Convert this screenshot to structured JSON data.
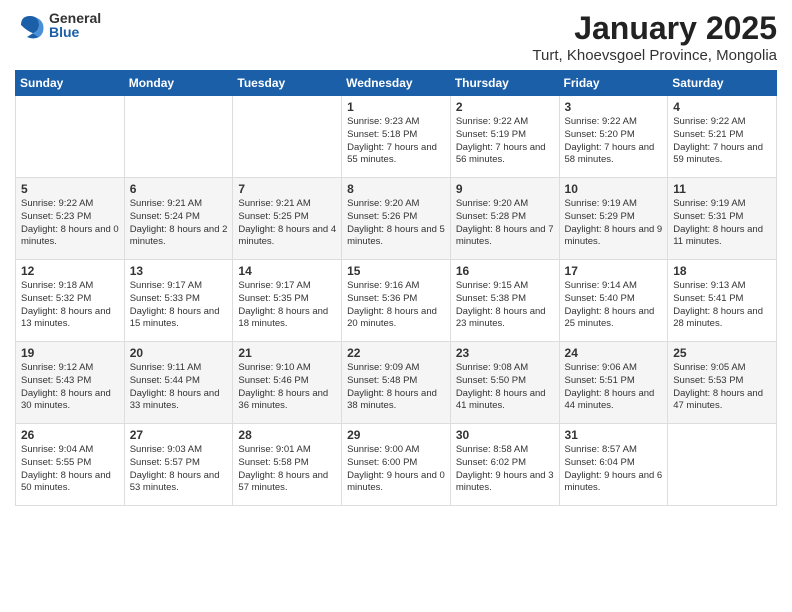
{
  "logo": {
    "general": "General",
    "blue": "Blue"
  },
  "title": "January 2025",
  "location": "Turt, Khoevsgoel Province, Mongolia",
  "weekdays": [
    "Sunday",
    "Monday",
    "Tuesday",
    "Wednesday",
    "Thursday",
    "Friday",
    "Saturday"
  ],
  "weeks": [
    [
      {
        "day": "",
        "detail": ""
      },
      {
        "day": "",
        "detail": ""
      },
      {
        "day": "",
        "detail": ""
      },
      {
        "day": "1",
        "detail": "Sunrise: 9:23 AM\nSunset: 5:18 PM\nDaylight: 7 hours\nand 55 minutes."
      },
      {
        "day": "2",
        "detail": "Sunrise: 9:22 AM\nSunset: 5:19 PM\nDaylight: 7 hours\nand 56 minutes."
      },
      {
        "day": "3",
        "detail": "Sunrise: 9:22 AM\nSunset: 5:20 PM\nDaylight: 7 hours\nand 58 minutes."
      },
      {
        "day": "4",
        "detail": "Sunrise: 9:22 AM\nSunset: 5:21 PM\nDaylight: 7 hours\nand 59 minutes."
      }
    ],
    [
      {
        "day": "5",
        "detail": "Sunrise: 9:22 AM\nSunset: 5:23 PM\nDaylight: 8 hours\nand 0 minutes."
      },
      {
        "day": "6",
        "detail": "Sunrise: 9:21 AM\nSunset: 5:24 PM\nDaylight: 8 hours\nand 2 minutes."
      },
      {
        "day": "7",
        "detail": "Sunrise: 9:21 AM\nSunset: 5:25 PM\nDaylight: 8 hours\nand 4 minutes."
      },
      {
        "day": "8",
        "detail": "Sunrise: 9:20 AM\nSunset: 5:26 PM\nDaylight: 8 hours\nand 5 minutes."
      },
      {
        "day": "9",
        "detail": "Sunrise: 9:20 AM\nSunset: 5:28 PM\nDaylight: 8 hours\nand 7 minutes."
      },
      {
        "day": "10",
        "detail": "Sunrise: 9:19 AM\nSunset: 5:29 PM\nDaylight: 8 hours\nand 9 minutes."
      },
      {
        "day": "11",
        "detail": "Sunrise: 9:19 AM\nSunset: 5:31 PM\nDaylight: 8 hours\nand 11 minutes."
      }
    ],
    [
      {
        "day": "12",
        "detail": "Sunrise: 9:18 AM\nSunset: 5:32 PM\nDaylight: 8 hours\nand 13 minutes."
      },
      {
        "day": "13",
        "detail": "Sunrise: 9:17 AM\nSunset: 5:33 PM\nDaylight: 8 hours\nand 15 minutes."
      },
      {
        "day": "14",
        "detail": "Sunrise: 9:17 AM\nSunset: 5:35 PM\nDaylight: 8 hours\nand 18 minutes."
      },
      {
        "day": "15",
        "detail": "Sunrise: 9:16 AM\nSunset: 5:36 PM\nDaylight: 8 hours\nand 20 minutes."
      },
      {
        "day": "16",
        "detail": "Sunrise: 9:15 AM\nSunset: 5:38 PM\nDaylight: 8 hours\nand 23 minutes."
      },
      {
        "day": "17",
        "detail": "Sunrise: 9:14 AM\nSunset: 5:40 PM\nDaylight: 8 hours\nand 25 minutes."
      },
      {
        "day": "18",
        "detail": "Sunrise: 9:13 AM\nSunset: 5:41 PM\nDaylight: 8 hours\nand 28 minutes."
      }
    ],
    [
      {
        "day": "19",
        "detail": "Sunrise: 9:12 AM\nSunset: 5:43 PM\nDaylight: 8 hours\nand 30 minutes."
      },
      {
        "day": "20",
        "detail": "Sunrise: 9:11 AM\nSunset: 5:44 PM\nDaylight: 8 hours\nand 33 minutes."
      },
      {
        "day": "21",
        "detail": "Sunrise: 9:10 AM\nSunset: 5:46 PM\nDaylight: 8 hours\nand 36 minutes."
      },
      {
        "day": "22",
        "detail": "Sunrise: 9:09 AM\nSunset: 5:48 PM\nDaylight: 8 hours\nand 38 minutes."
      },
      {
        "day": "23",
        "detail": "Sunrise: 9:08 AM\nSunset: 5:50 PM\nDaylight: 8 hours\nand 41 minutes."
      },
      {
        "day": "24",
        "detail": "Sunrise: 9:06 AM\nSunset: 5:51 PM\nDaylight: 8 hours\nand 44 minutes."
      },
      {
        "day": "25",
        "detail": "Sunrise: 9:05 AM\nSunset: 5:53 PM\nDaylight: 8 hours\nand 47 minutes."
      }
    ],
    [
      {
        "day": "26",
        "detail": "Sunrise: 9:04 AM\nSunset: 5:55 PM\nDaylight: 8 hours\nand 50 minutes."
      },
      {
        "day": "27",
        "detail": "Sunrise: 9:03 AM\nSunset: 5:57 PM\nDaylight: 8 hours\nand 53 minutes."
      },
      {
        "day": "28",
        "detail": "Sunrise: 9:01 AM\nSunset: 5:58 PM\nDaylight: 8 hours\nand 57 minutes."
      },
      {
        "day": "29",
        "detail": "Sunrise: 9:00 AM\nSunset: 6:00 PM\nDaylight: 9 hours\nand 0 minutes."
      },
      {
        "day": "30",
        "detail": "Sunrise: 8:58 AM\nSunset: 6:02 PM\nDaylight: 9 hours\nand 3 minutes."
      },
      {
        "day": "31",
        "detail": "Sunrise: 8:57 AM\nSunset: 6:04 PM\nDaylight: 9 hours\nand 6 minutes."
      },
      {
        "day": "",
        "detail": ""
      }
    ]
  ]
}
